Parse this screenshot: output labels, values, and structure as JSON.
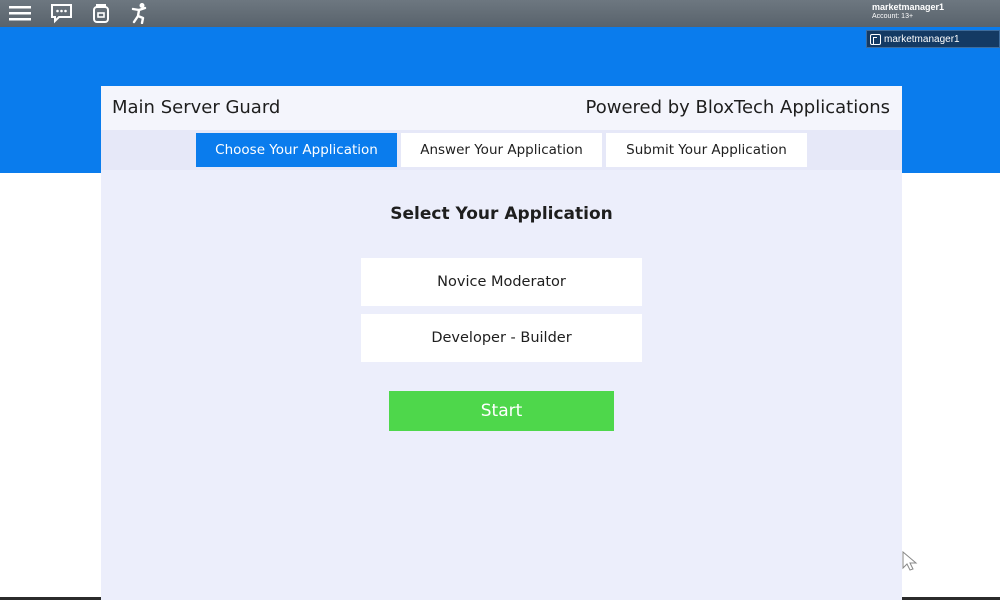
{
  "topbar": {
    "icons": [
      "menu-icon",
      "chat-icon",
      "backpack-icon",
      "emote-icon"
    ],
    "account_name": "marketmanager1",
    "account_age": "Account: 13+"
  },
  "playerlist": {
    "player_name": "marketmanager1"
  },
  "panel": {
    "title": "Main Server Guard",
    "powered_by": "Powered by BloxTech Applications",
    "tabs": [
      {
        "label": "Choose Your Application",
        "active": true
      },
      {
        "label": "Answer Your Application",
        "active": false
      },
      {
        "label": "Submit Your Application",
        "active": false
      }
    ],
    "section_title": "Select Your Application",
    "options": [
      {
        "label": "Novice Moderator"
      },
      {
        "label": "Developer - Builder"
      }
    ],
    "start_label": "Start"
  },
  "colors": {
    "accent_blue": "#0a7ced",
    "start_green": "#4ed74b",
    "panel_bg": "#eceefb",
    "topbar_gray": "#5f6a73"
  }
}
